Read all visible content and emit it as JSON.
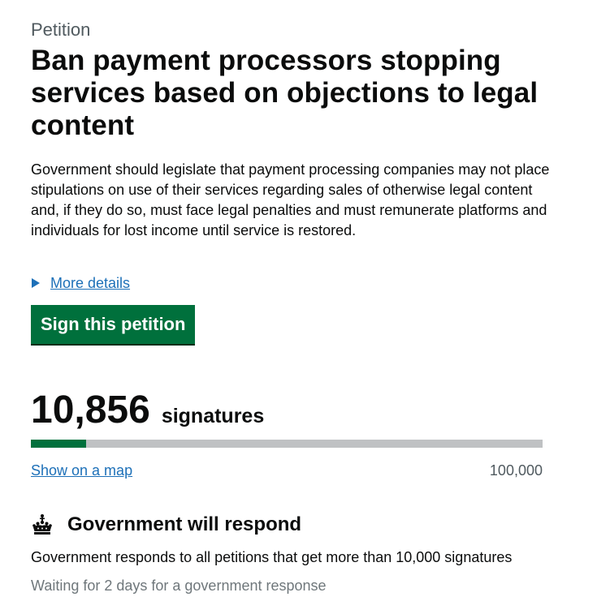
{
  "caption": "Petition",
  "title": "Ban payment processors stopping services based on objections to legal content",
  "summary": "Government should legislate that payment processing companies may not place stipulations on use of their services regarding sales of otherwise legal content and, if they do so, must face legal penalties and must remunerate platforms and individuals for lost income until service is restored.",
  "details_link": "More details",
  "sign_button": "Sign this petition",
  "signatures": {
    "count": "10,856",
    "label": "signatures",
    "progress_fraction": 0.10856
  },
  "map_link": "Show on a map",
  "threshold": "100,000",
  "response": {
    "icon": "crown-icon",
    "heading": "Government will respond",
    "text": "Government responds to all petitions that get more than 10,000 signatures",
    "waiting": "Waiting for 2 days for a government response"
  },
  "colors": {
    "accent_green": "#00703c",
    "link_blue": "#1d70b8",
    "progress_track": "#bfc1c3"
  }
}
